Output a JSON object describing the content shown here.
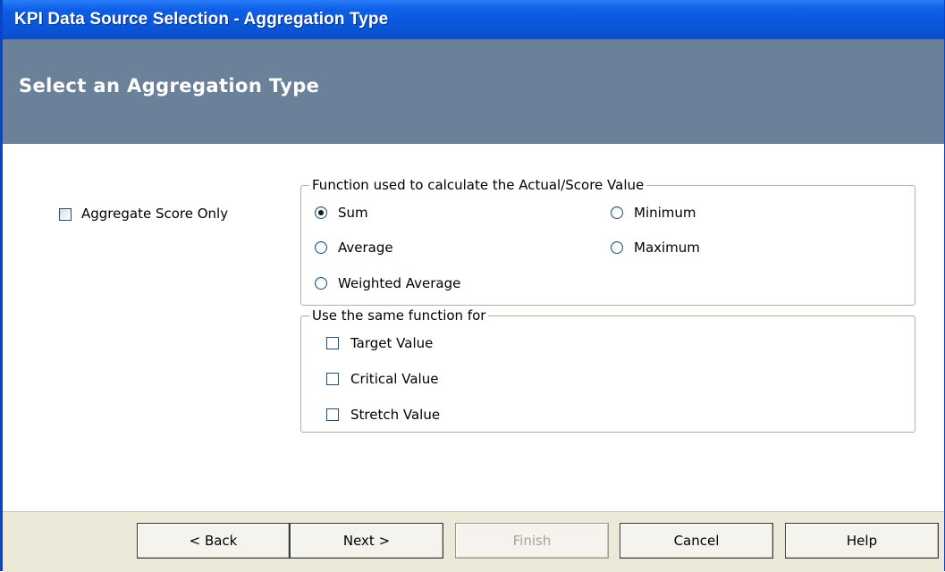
{
  "window": {
    "title": "KPI Data Source Selection - Aggregation Type"
  },
  "header": {
    "title": "Select an Aggregation Type"
  },
  "aggregate_score_only": {
    "label": "Aggregate Score Only",
    "checked": false
  },
  "function_group": {
    "legend": "Function used to calculate the Actual/Score Value",
    "options": [
      {
        "label": "Sum",
        "checked": true
      },
      {
        "label": "Average",
        "checked": false
      },
      {
        "label": "Weighted Average",
        "checked": false
      },
      {
        "label": "Minimum",
        "checked": false
      },
      {
        "label": "Maximum",
        "checked": false
      }
    ]
  },
  "same_function_group": {
    "legend": "Use the same function for",
    "options": [
      {
        "label": "Target Value",
        "checked": false
      },
      {
        "label": "Critical Value",
        "checked": false
      },
      {
        "label": "Stretch Value",
        "checked": false
      }
    ]
  },
  "buttons": {
    "back": "< Back",
    "next": "Next >",
    "finish": "Finish",
    "cancel": "Cancel",
    "help": "Help"
  }
}
